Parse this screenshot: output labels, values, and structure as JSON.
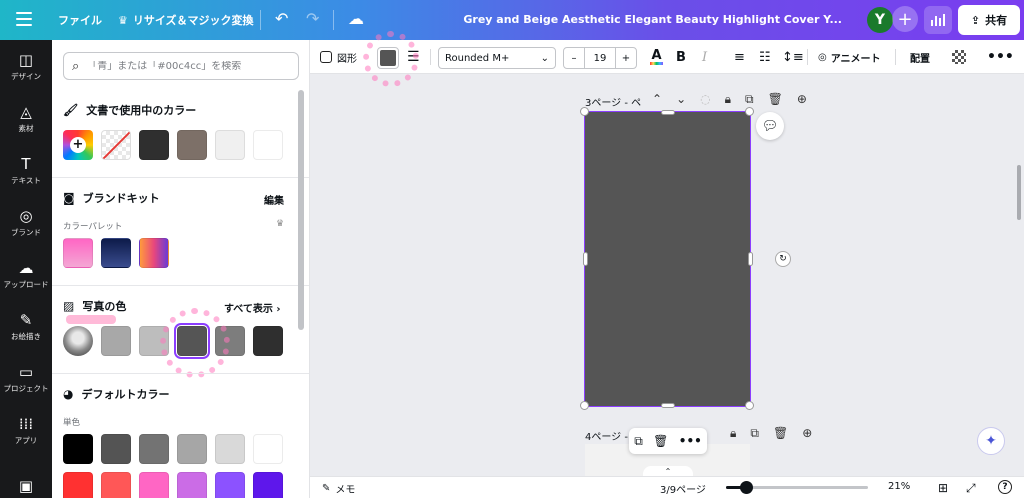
{
  "topbar": {
    "file": "ファイル",
    "resize": "リサイズ＆マジック変換",
    "title": "Grey and Beige Aesthetic Elegant Beauty  Highlight Cover Y...",
    "avatar": "Y",
    "share": "共有"
  },
  "rail": [
    {
      "label": "デザイン",
      "icon": "design-icon",
      "glyph": "◫"
    },
    {
      "label": "素材",
      "icon": "elements-icon",
      "glyph": "◬"
    },
    {
      "label": "テキスト",
      "icon": "text-icon",
      "glyph": "T"
    },
    {
      "label": "ブランド",
      "icon": "brand-icon",
      "glyph": "◎"
    },
    {
      "label": "アップロード",
      "icon": "upload-icon",
      "glyph": "☁"
    },
    {
      "label": "お絵描き",
      "icon": "draw-icon",
      "glyph": "✎"
    },
    {
      "label": "プロジェクト",
      "icon": "folder-icon",
      "glyph": "▭"
    },
    {
      "label": "アプリ",
      "icon": "apps-icon",
      "glyph": "⁞⁞⁞"
    }
  ],
  "panel": {
    "search_placeholder": "「青」または「#00c4cc」を検索",
    "doc_colors": {
      "title": "文書で使用中のカラー",
      "swatches": [
        "#2f2f2f",
        "#7d7068",
        "#f0f0f0",
        "#ffffff"
      ]
    },
    "brand_kit": {
      "title": "ブランドキット",
      "edit": "編集",
      "palette_label": "カラーパレット"
    },
    "photo_colors": {
      "title": "写真の色",
      "see_all": "すべて表示",
      "swatches": [
        "#a8a8a8",
        "#bdbdbd",
        "#555555",
        "#7d7d7d",
        "#2f2f2f"
      ],
      "selected_index": 2
    },
    "default_colors": {
      "title": "デフォルトカラー",
      "solid_label": "単色",
      "row1": [
        "#000000",
        "#545454",
        "#737373",
        "#a6a6a6",
        "#d9d9d9",
        "#ffffff"
      ],
      "row2": [
        "#ff3131",
        "#ff5757",
        "#ff66c4",
        "#cb6ce6",
        "#8c52ff",
        "#5e17eb"
      ]
    }
  },
  "toolbar": {
    "shape": "図形",
    "fill_color": "#555555",
    "font": "Rounded M+",
    "font_size": "19",
    "bold": "B",
    "italic": "I",
    "animate": "アニメート",
    "position": "配置"
  },
  "canvas": {
    "page3_label": "3ページ - ペ",
    "page4_label": "4ページ -",
    "page_color": "#555555"
  },
  "bottom": {
    "notes": "メモ",
    "page_counter": "3/9ページ",
    "zoom": "21%",
    "zoom_level": 0.21
  }
}
